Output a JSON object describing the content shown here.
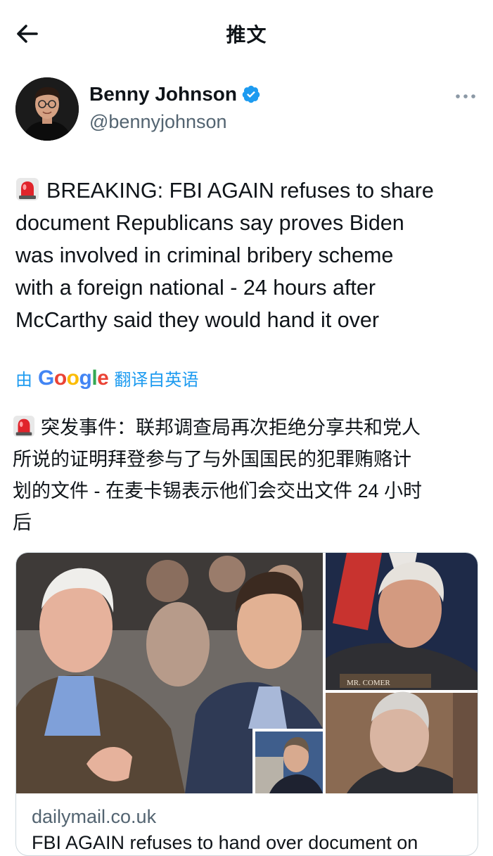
{
  "header": {
    "title": "推文"
  },
  "author": {
    "name": "Benny Johnson",
    "handle": "@bennyjohnson",
    "verified": true
  },
  "tweet": {
    "lines": [
      "BREAKING: FBI AGAIN refuses to share",
      "document Republicans say proves Biden",
      "was involved in criminal bribery scheme",
      "with a foreign national - 24 hours after",
      "McCarthy said they would hand it over"
    ]
  },
  "translation": {
    "by": "由",
    "provider": [
      "G",
      "o",
      "o",
      "g",
      "l",
      "e"
    ],
    "suffix": "翻译自英语",
    "lines": [
      "突发事件：联邦调查局再次拒绝分享共和党人",
      "所说的证明拜登参与了与外国国民的犯罪贿赂计",
      "划的文件 - 在麦卡锡表示他们会交出文件 24 小时",
      "后"
    ]
  },
  "card": {
    "domain": "dailymail.co.uk",
    "title": "FBI AGAIN refuses to hand over document on",
    "image_label": "MR. COMER"
  },
  "colors": {
    "accent": "#1d9bf0",
    "google_blue": "#4285f4",
    "google_red": "#ea4335",
    "google_yellow": "#fbbc05",
    "google_green": "#34a853"
  },
  "icons": [
    "back-arrow-icon",
    "verified-badge-icon",
    "more-options-icon",
    "siren-emoji-icon"
  ]
}
